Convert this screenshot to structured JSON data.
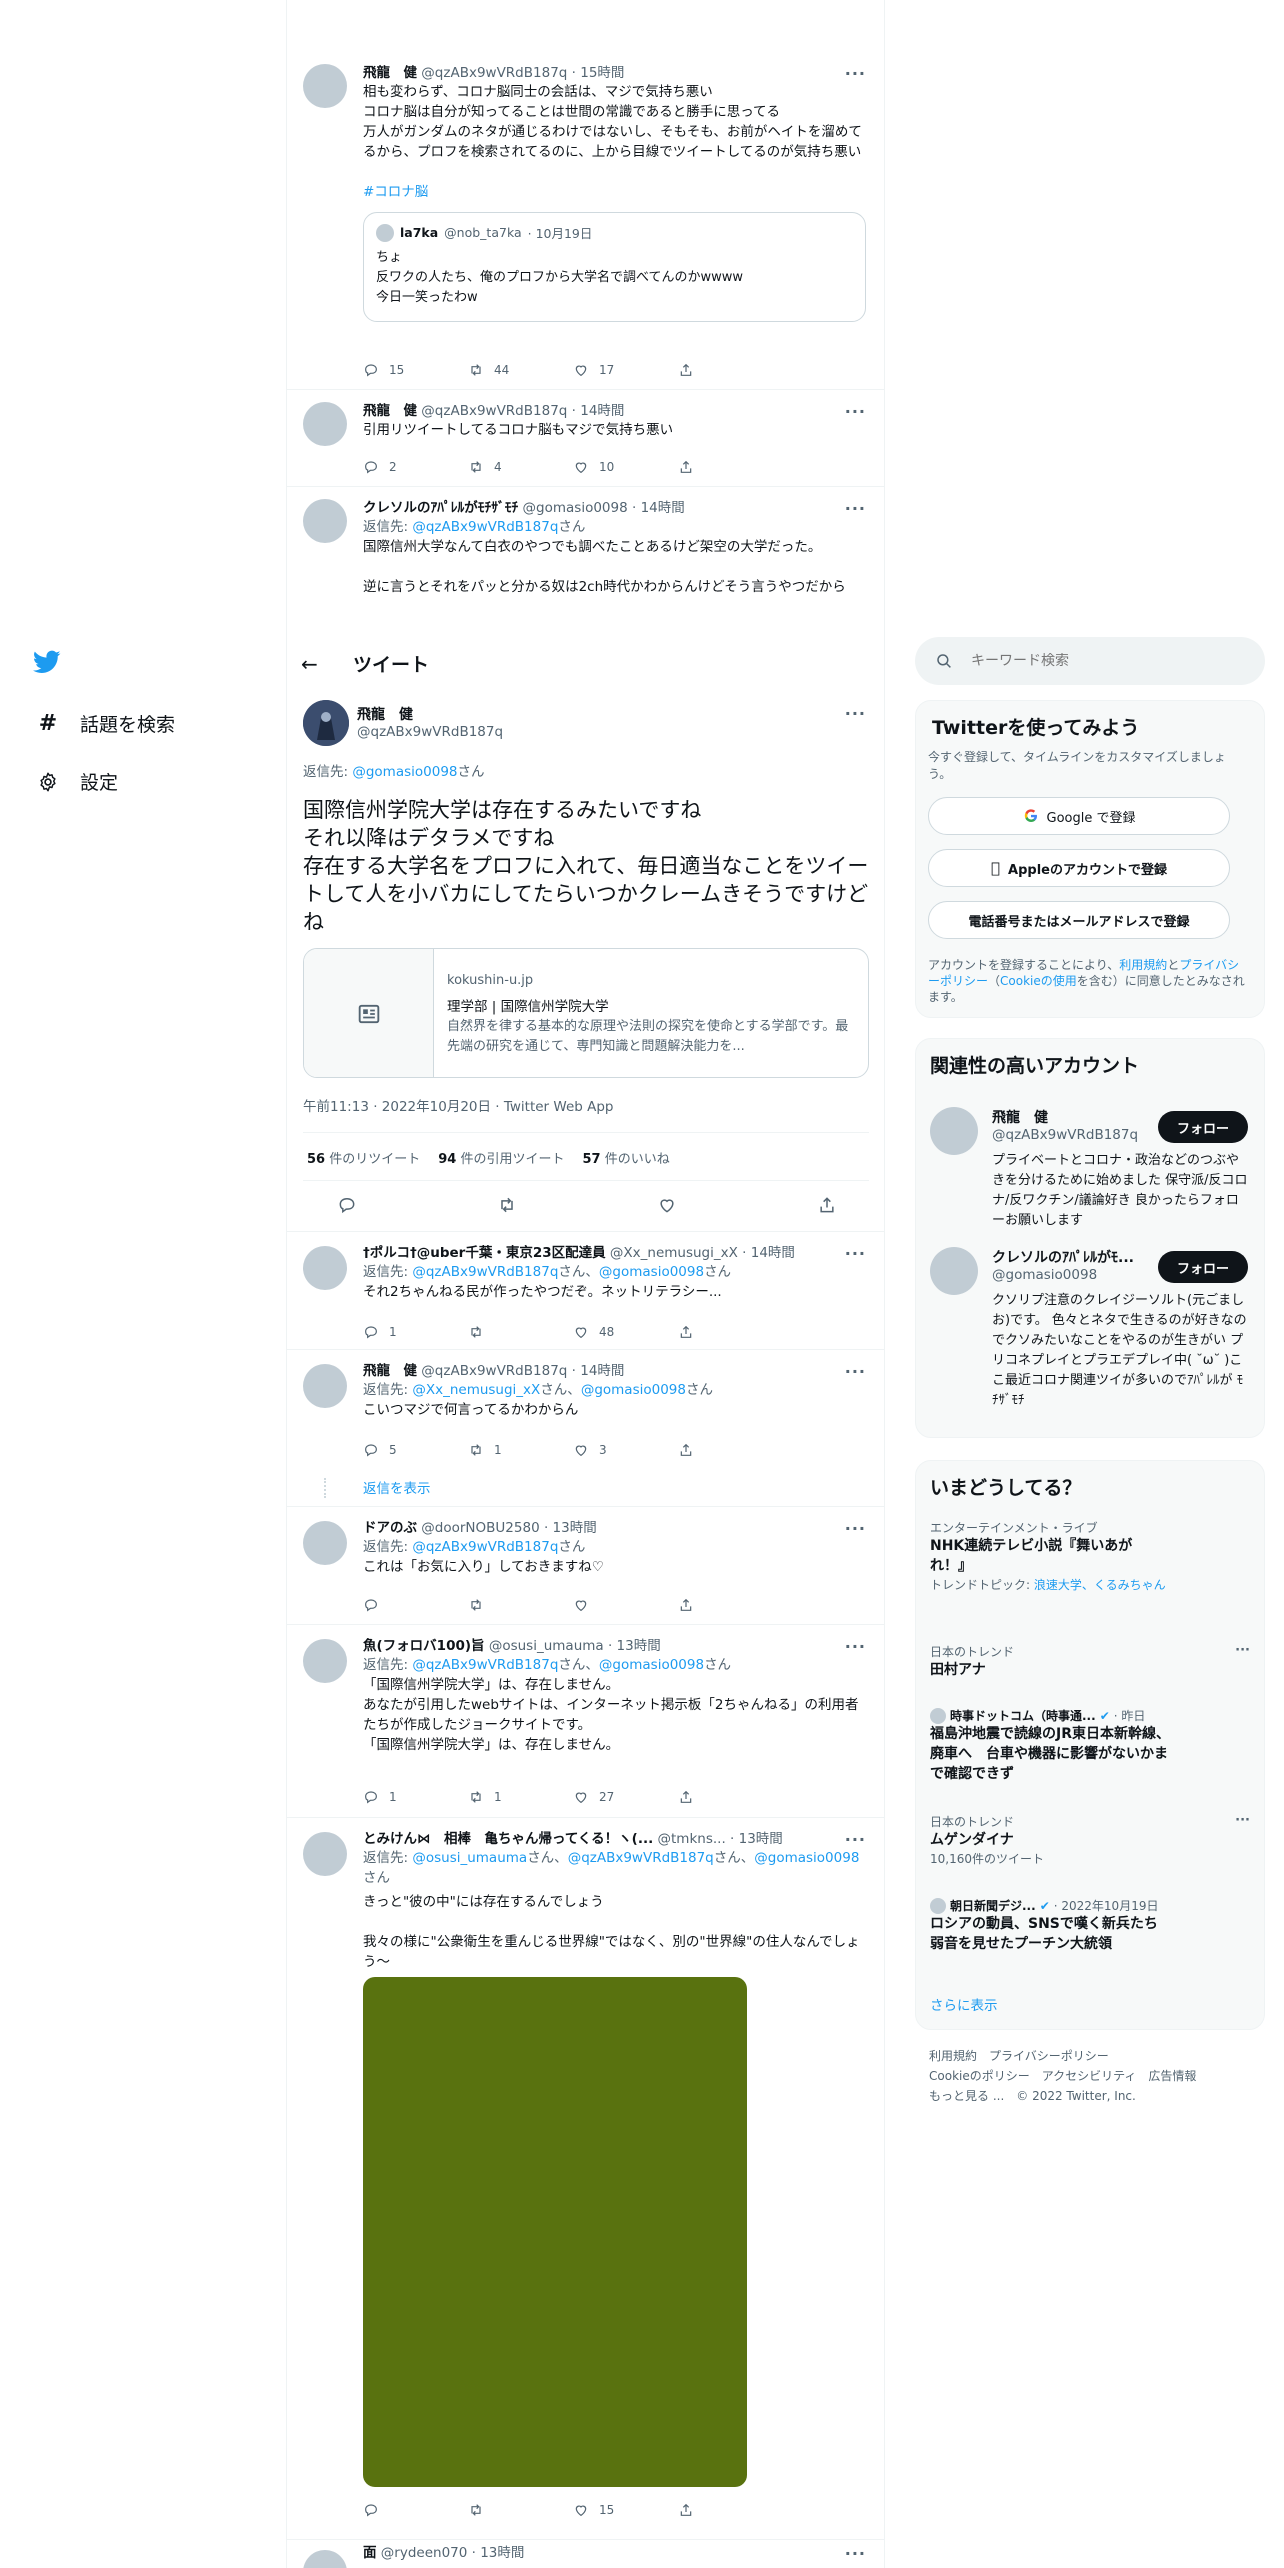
{
  "nav": {
    "explore_label": "話題を検索",
    "settings_label": "設定"
  },
  "header": {
    "back_label": "←",
    "title": "ツイート"
  },
  "top_tweets": [
    {
      "name": "飛龍　健",
      "handle": "@qzABx9wVRdB187q",
      "time": "· 15時間",
      "text": "相も変わらず、コロナ脳同士の会話は、マジで気持ち悪い\nコロナ脳は自分が知ってることは世間の常識であると勝手に思ってる\n万人がガンダムのネタが通じるわけではないし、そもそも、お前がヘイトを溜めてるから、プロフを検索されてるのに、上から目線でツイートしてるのが気持ち悪い",
      "hashtag": "#コロナ脳",
      "quote": {
        "name": "la7ka",
        "handle": "@nob_ta7ka",
        "time": "· 10月19日",
        "text": "ちょ\n反ワクの人たち、俺のプロフから大学名で調べてんのかwwww\n今日一笑ったわw"
      },
      "replies": "15",
      "retweets": "44",
      "likes": "17"
    },
    {
      "name": "飛龍　健",
      "handle": "@qzABx9wVRdB187q",
      "time": "· 14時間",
      "text": "引用リツイートしてるコロナ脳もマジで気持ち悪い",
      "replies": "2",
      "retweets": "4",
      "likes": "10"
    },
    {
      "name": "クレソルのｱﾊﾟﾚﾙがﾓﾁｻﾞﾓﾁ",
      "handle": "@gomasio0098",
      "time": "· 14時間",
      "reply_prefix": "返信先: ",
      "reply_to": "@qzABx9wVRdB187q",
      "reply_suffix": "さん",
      "text": "国際信州大学なんて白衣のやつでも調べたことあるけど架空の大学だった。\n\n逆に言うとそれをパッと分かる奴は2ch時代かわからんけどそう言うやつだから"
    }
  ],
  "main_tweet": {
    "name": "飛龍　健",
    "handle": "@qzABx9wVRdB187q",
    "reply_prefix": "返信先: ",
    "reply_to": "@gomasio0098",
    "reply_suffix": "さん",
    "text": "国際信州学院大学は存在するみたいですね\nそれ以降はデタラメですね\n存在する大学名をプロフに入れて、毎日適当なことをツイートして人を小バカにしてたらいつかクレームきそうですけどね",
    "card": {
      "domain": "kokushin-u.jp",
      "title": "理学部 | 国際信州学院大学",
      "desc": "自然界を律する基本的な原理や法則の探究を使命とする学部です。最先端の研究を通じて、専門知識と問題解決能力を..."
    },
    "timestamp": "午前11:13 · 2022年10月20日 · Twitter Web App",
    "retweets_count": "56",
    "retweets_label": " 件のリツイート",
    "quotes_count": "94",
    "quotes_label": " 件の引用ツイート",
    "likes_count": "57",
    "likes_label": " 件のいいね"
  },
  "replies": [
    {
      "name": "†ポルコ†@uber千葉・東京23区配達員",
      "handle": "@Xx_nemusugi_xX",
      "time": "· 14時間",
      "reply_prefix": "返信先: ",
      "reply_to": "@qzABx9wVRdB187q",
      "reply_mid": "さん、",
      "reply_to2": "@gomasio0098",
      "reply_suffix": "さん",
      "text": "それ2ちゃんねる民が作ったやつだぞ。ネットリテラシー...",
      "replies": "1",
      "retweets": "",
      "likes": "48"
    },
    {
      "name": "飛龍　健",
      "handle": "@qzABx9wVRdB187q",
      "time": "· 14時間",
      "reply_prefix": "返信先: ",
      "reply_to": "@Xx_nemusugi_xX",
      "reply_mid": "さん、",
      "reply_to2": "@gomasio0098",
      "reply_suffix": "さん",
      "text": "こいつマジで何言ってるかわからん",
      "replies": "5",
      "retweets": "1",
      "likes": "3",
      "show_replies": "返信を表示"
    },
    {
      "name": "ドアのぶ",
      "handle": "@doorNOBU2580",
      "time": "· 13時間",
      "reply_prefix": "返信先: ",
      "reply_to": "@qzABx9wVRdB187q",
      "reply_suffix": "さん",
      "text": "これは「お気に入り」しておきますね♡",
      "replies": "",
      "retweets": "",
      "likes": ""
    },
    {
      "name": "魚(フォロバ100)旨",
      "handle": "@osusi_umauma",
      "time": "· 13時間",
      "reply_prefix": "返信先: ",
      "reply_to": "@qzABx9wVRdB187q",
      "reply_mid": "さん、",
      "reply_to2": "@gomasio0098",
      "reply_suffix": "さん",
      "text": "「国際信州学院大学」は、存在しません。\nあなたが引用したwebサイトは、インターネット掲示板「2ちゃんねる」の利用者たちが作成したジョークサイトです。\n「国際信州学院大学」は、存在しません。",
      "replies": "1",
      "retweets": "1",
      "likes": "27"
    },
    {
      "name": "とみけん⋈　相棒　亀ちゃん帰ってくる！ヽ(...",
      "handle": "@tmkns...",
      "time": "· 13時間",
      "reply_prefix": "返信先: ",
      "reply_to": "@osusi_umauma",
      "reply_mid": "さん、",
      "reply_to2": "@qzABx9wVRdB187q",
      "reply_mid2": "さん、",
      "reply_to3": "@gomasio0098",
      "reply_suffix": "さん",
      "text": "きっと\"彼の中\"には存在するんでしょう\n\n我々の様に\"公衆衛生を重んじる世界線\"ではなく、別の\"世界線\"の住人なんでしょう〜",
      "media_color": "#59720f",
      "replies": "",
      "retweets": "",
      "likes": "15"
    },
    {
      "name": "面",
      "handle": "@rydeen070",
      "time": "· 13時間"
    }
  ],
  "search": {
    "placeholder": "キーワード検索"
  },
  "signup": {
    "title": "Twitterを使ってみよう",
    "subtitle": "今すぐ登録して、タイムラインをカスタマイズしましょう。",
    "google_label": "Google で登録",
    "apple_label": "Appleのアカウントで登録",
    "phone_label": "電話番号またはメールアドレスで登録",
    "legal_1": "アカウントを登録することにより、",
    "legal_tos": "利用規約",
    "legal_2": "と",
    "legal_privacy": "プライバシーポリシー",
    "legal_3": "（",
    "legal_cookie": "Cookieの使用",
    "legal_4": "を含む）に同意したとみなされます。"
  },
  "related": {
    "title": "関連性の高いアカウント",
    "follow_label": "フォロー",
    "accounts": [
      {
        "name": "飛龍　健",
        "handle": "@qzABx9wVRdB187q",
        "bio": "プライベートとコロナ・政治などのつぶやきを分けるために始めました 保守派/反コロナ/反ワクチン/議論好き 良かったらフォローお願いします"
      },
      {
        "name": "クレソルのｱﾊﾟﾚﾙがﾓ...",
        "handle": "@gomasio0098",
        "bio": "クソリプ注意のクレイジーソルト(元ごましお)です。 色々とネタで生きるのが好きなのでクソみたいなことをやるのが生きがい プリコネプレイとプラエデプレイ中( ˘ω˘ )ここ最近コロナ関連ツイが多いのでｱﾊﾟﾚﾙが ﾓﾁｻﾞﾓﾁ"
      }
    ]
  },
  "trends": {
    "title": "いまどうしてる？",
    "items": [
      {
        "category": "エンターテインメント・ライブ",
        "title": "NHK連続テレビ小説『舞いあがれ！』",
        "topic_prefix": "トレンドトピック: ",
        "topic_links": "浪速大学、くるみちゃん"
      },
      {
        "category": "日本のトレンド",
        "title": "田村アナ"
      },
      {
        "source": "時事ドットコム（時事通...",
        "time": "· 昨日",
        "title": "福島沖地震で読線のJR東日本新幹線、廃車へ　台車や機器に影響がないかまで確認できず"
      },
      {
        "category": "日本のトレンド",
        "title": "ムゲンダイナ",
        "count": "10,160件のツイート"
      },
      {
        "source": "朝日新聞デジ...",
        "time": "· 2022年10月19日",
        "title": "ロシアの動員、SNSで嘆く新兵たち　弱音を見せたプーチン大統領"
      }
    ],
    "show_more": "さらに表示"
  },
  "footer": {
    "line1": "利用規約　プライバシーポリシー",
    "line2": "Cookieのポリシー　アクセシビリティ　広告情報",
    "line3": "もっと見る ...　© 2022 Twitter, Inc."
  },
  "colors": {
    "accent": "#1d9bf0",
    "text": "#0f1419",
    "muted": "#536471",
    "border": "#eff3f4"
  }
}
